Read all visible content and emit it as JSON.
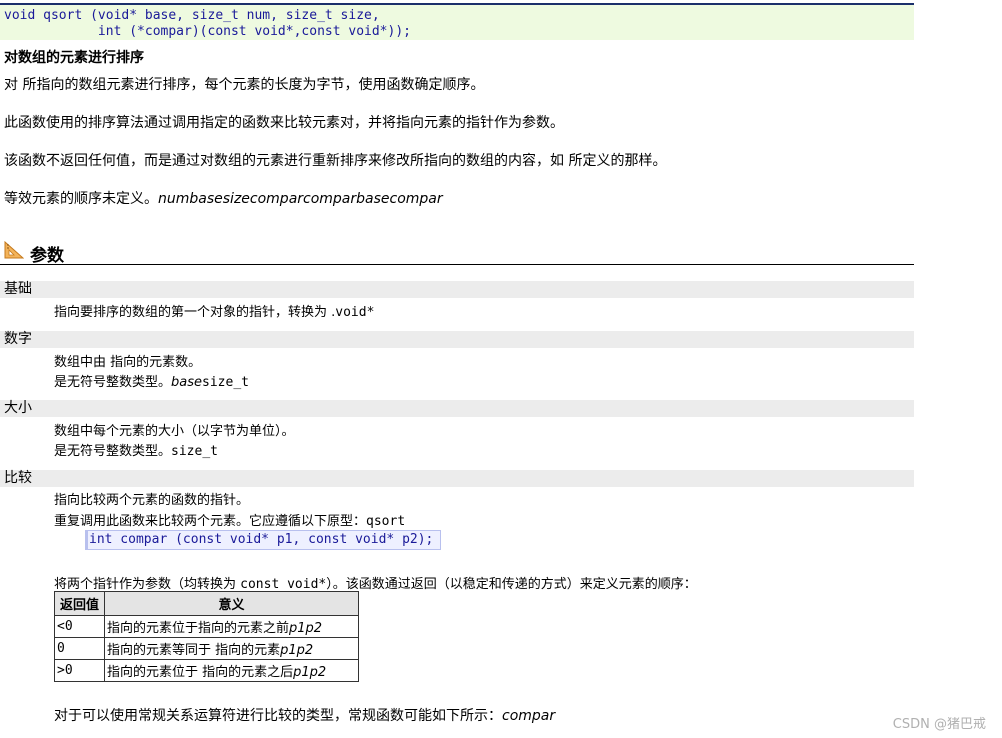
{
  "prototype": {
    "line1": "void qsort (void* base, size_t num, size_t size,",
    "line2": "            int (*compar)(const void*,const void*));"
  },
  "title": "对数组的元素进行排序",
  "paragraphs": [
    {
      "text": "对 所指向的数组元素进行排序，每个元素的长度为字节，使用函数确定顺序。",
      "italic": ""
    },
    {
      "text": "此函数使用的排序算法通过调用指定的函数来比较元素对，并将指向元素的指针作为参数。",
      "italic": ""
    },
    {
      "text": "该函数不返回任何值，而是通过对数组的元素进行重新排序来修改所指向的数组的内容，如 所定义的那样。",
      "italic": ""
    },
    {
      "text": "等效元素的顺序未定义。",
      "italic": "numbasesizecomparcomparbasecompar"
    }
  ],
  "params_heading": "参数",
  "params": {
    "base": {
      "name": "基础",
      "desc1": "指向要排序的数组的第一个对象的指针，转换为 .",
      "desc1_code": "void*"
    },
    "num": {
      "name": "数字",
      "desc1": "数组中由 指向的元素数。",
      "desc2": "是无符号整数类型。",
      "desc2_it": "base",
      "desc2_code": "size_t"
    },
    "size": {
      "name": "大小",
      "desc1": "数组中每个元素的大小（以字节为单位）。",
      "desc2": "是无符号整数类型。",
      "desc2_code": "size_t"
    },
    "compar": {
      "name": "比较",
      "desc1": "指向比较两个元素的函数的指针。",
      "desc2": "重复调用此函数来比较两个元素。它应遵循以下原型：",
      "desc2_code": "qsort",
      "code": "int compar (const void* p1, const void* p2);",
      "desc3a": "将两个指针作为参数（均转换为 ",
      "desc3_code": "const void*",
      "desc3b": "）。该函数通过返回（以稳定和传递的方式）来定义元素的顺序："
    }
  },
  "return_table": {
    "headers": [
      "返回值",
      "意义"
    ],
    "rows": [
      {
        "value": "<0",
        "text": "指向的元素位于指向的元素之前",
        "it": "p1p2"
      },
      {
        "value": "0",
        "text": "指向的元素等同于 指向的元素",
        "it": "p1p2"
      },
      {
        "value": ">0",
        "text": "指向的元素位于 指向的元素之后",
        "it": "p1p2"
      }
    ]
  },
  "footer": {
    "text": "对于可以使用常规关系运算符进行比较的类型，常规函数可能如下所示：",
    "it": "compar"
  },
  "watermark": "CSDN @猪巴戒",
  "colors": {
    "proto_bg": "#eefae0",
    "proto_border": "#1b2f6b",
    "code_text": "#1a1a99",
    "param_bar": "#ececec"
  }
}
